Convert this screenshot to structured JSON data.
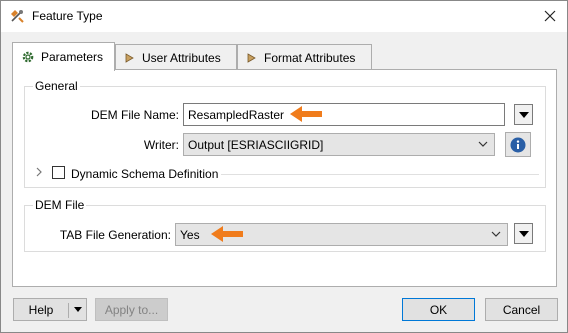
{
  "window": {
    "title": "Feature Type"
  },
  "tabs": [
    {
      "label": "Parameters",
      "icon": "gear-icon"
    },
    {
      "label": "User Attributes",
      "icon": "arrow-right-icon"
    },
    {
      "label": "Format Attributes",
      "icon": "arrow-right-icon"
    }
  ],
  "general": {
    "group_label": "General",
    "dem_file_name_label": "DEM File Name:",
    "dem_file_name_value": "ResampledRaster",
    "writer_label": "Writer:",
    "writer_value": "Output [ESRIASCIIGRID]",
    "dynamic_schema_label": "Dynamic Schema Definition"
  },
  "dem_file": {
    "group_label": "DEM File",
    "tab_file_generation_label": "TAB File Generation:",
    "tab_file_generation_value": "Yes"
  },
  "footer": {
    "help_label": "Help",
    "apply_label": "Apply to...",
    "ok_label": "OK",
    "cancel_label": "Cancel"
  },
  "colors": {
    "accent_arrow": "#f07c1c",
    "info": "#2a5fa6",
    "primary_border": "#0078d7"
  }
}
